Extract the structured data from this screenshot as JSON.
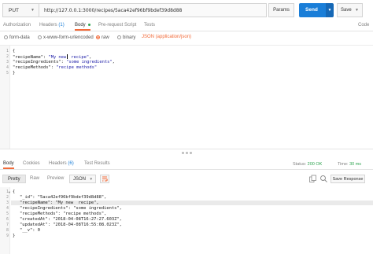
{
  "request": {
    "method": "PUT",
    "url": "http://127.0.0.1:3000/recipes/5aca42ef96bf9bdef39d8d88",
    "params_label": "Params",
    "send_label": "Send",
    "save_label": "Save"
  },
  "request_tabs": {
    "authorization": "Authorization",
    "headers": "Headers",
    "headers_count": "(1)",
    "body": "Body",
    "prerequest": "Pre-request Script",
    "tests": "Tests",
    "code": "Code"
  },
  "body_options": {
    "formdata": "form-data",
    "urlencoded": "x-www-form-urlencoded",
    "raw": "raw",
    "binary": "binary",
    "content_type": "JSON (application/json)"
  },
  "request_body": {
    "line1": "{",
    "line2_key": "\"recipeName\"",
    "line2_sep": ": ",
    "line2_val_a": "\"My new",
    "line2_val_b": " recipe\"",
    "line2_end": ",",
    "line3_key": "\"recipeIngredients\"",
    "line3_sep": ": ",
    "line3_val": "\"some ingredients\"",
    "line3_end": ",",
    "line4_key": "\"recipeMethods\"",
    "line4_sep": ": ",
    "line4_val": "\"recipe methods\"",
    "line5": "}"
  },
  "response_tabs": {
    "body": "Body",
    "cookies": "Cookies",
    "headers": "Headers",
    "headers_count": "(6)",
    "tests": "Test Results",
    "status_label": "Status:",
    "status_value": "200 OK",
    "time_label": "Time:",
    "time_value": "30 ms"
  },
  "response_toolbar": {
    "pretty": "Pretty",
    "raw": "Raw",
    "preview": "Preview",
    "format": "JSON",
    "save_response": "Save Response"
  },
  "response_body": {
    "open": "{",
    "l2": "\"_id\": \"5aca42ef96bf9bdef39d8d88\",",
    "l3": "\"recipeName\": \"My new  recipe\",",
    "l4": "\"recipeIngredients\": \"some ingredients\",",
    "l5": "\"recipeMethods\": \"recipe methods\",",
    "l6": "\"createdAt\": \"2018-04-08T16:27:27.603Z\",",
    "l7": "\"updatedAt\": \"2018-04-08T16:55:08.023Z\",",
    "l8": "\"__v\": 0",
    "close": "}"
  },
  "line_numbers": [
    "1",
    "2",
    "3",
    "4",
    "5",
    "6",
    "7",
    "8",
    "9"
  ],
  "colors": {
    "accent_orange": "#f26b3a",
    "send_blue": "#1a7ed8",
    "status_green": "#2ea44f"
  }
}
